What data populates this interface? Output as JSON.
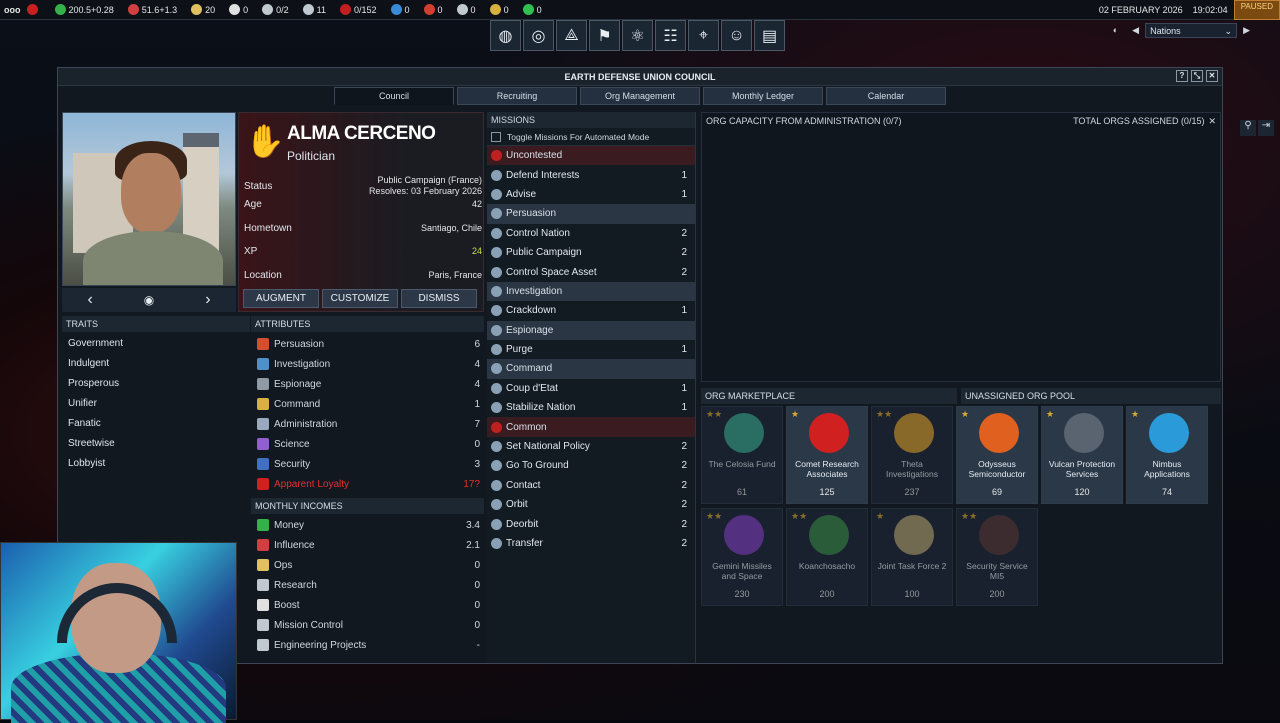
{
  "topbar": {
    "menu": "ooo",
    "resources": [
      {
        "name": "control-points",
        "value": "",
        "color": "#c82020"
      },
      {
        "name": "money",
        "value": "200.5+0.28",
        "color": "#36b04a"
      },
      {
        "name": "influence",
        "value": "51.6+1.3",
        "color": "#d04040"
      },
      {
        "name": "ops",
        "value": "20",
        "color": "#e0c060"
      },
      {
        "name": "boost",
        "value": "0",
        "color": "#e0e0e0"
      },
      {
        "name": "mission-control",
        "value": "0/2",
        "color": "#c0c8d0"
      },
      {
        "name": "research",
        "value": "11",
        "color": "#c0c8d0"
      },
      {
        "name": "mc-cap",
        "value": "0/152",
        "color": "#c02020"
      },
      {
        "name": "water",
        "value": "0",
        "color": "#3a8ad8"
      },
      {
        "name": "volatiles",
        "value": "0",
        "color": "#d04030"
      },
      {
        "name": "metals",
        "value": "0",
        "color": "#c0c8d0"
      },
      {
        "name": "noble-metals",
        "value": "0",
        "color": "#d8b040"
      },
      {
        "name": "fissiles",
        "value": "0",
        "color": "#30c050"
      }
    ],
    "date": "02 FEBRUARY 2026",
    "time": "19:02:04",
    "paused": "PAUSED",
    "nations_select": "Nations"
  },
  "window": {
    "title": "EARTH DEFENSE UNION COUNCIL",
    "tabs": [
      "Council",
      "Recruiting",
      "Org Management",
      "Monthly Ledger",
      "Calendar"
    ]
  },
  "councilor": {
    "name": "ALMA CERCENO",
    "role": "Politician",
    "status_label": "Status",
    "status_value": "Public Campaign (France)",
    "status_resolves": "Resolves: 03 February 2026",
    "age_label": "Age",
    "age": "42",
    "hometown_label": "Hometown",
    "hometown": "Santiago, Chile",
    "xp_label": "XP",
    "xp": "24",
    "location_label": "Location",
    "location": "Paris, France",
    "buttons": {
      "augment": "AUGMENT",
      "customize": "CUSTOMIZE",
      "dismiss": "DISMISS"
    }
  },
  "traits": {
    "header": "TRAITS",
    "items": [
      "Government",
      "Indulgent",
      "Prosperous",
      "Unifier",
      "Fanatic",
      "Streetwise",
      "Lobbyist"
    ]
  },
  "attributes": {
    "header": "ATTRIBUTES",
    "items": [
      {
        "label": "Persuasion",
        "value": "6",
        "color": "#d05030"
      },
      {
        "label": "Investigation",
        "value": "4",
        "color": "#5090c8"
      },
      {
        "label": "Espionage",
        "value": "4",
        "color": "#909aa4"
      },
      {
        "label": "Command",
        "value": "1",
        "color": "#d8b040"
      },
      {
        "label": "Administration",
        "value": "7",
        "color": "#9aa8c0"
      },
      {
        "label": "Science",
        "value": "0",
        "color": "#9060d0"
      },
      {
        "label": "Security",
        "value": "3",
        "color": "#4070c0"
      },
      {
        "label": "Apparent Loyalty",
        "value": "17?",
        "color": "#d02020"
      }
    ]
  },
  "incomes": {
    "header": "MONTHLY INCOMES",
    "items": [
      {
        "label": "Money",
        "value": "3.4",
        "color": "#36b04a"
      },
      {
        "label": "Influence",
        "value": "2.1",
        "color": "#d04040"
      },
      {
        "label": "Ops",
        "value": "0",
        "color": "#e0c060"
      },
      {
        "label": "Research",
        "value": "0",
        "color": "#c0c8d0"
      },
      {
        "label": "Boost",
        "value": "0",
        "color": "#e0e0e0"
      },
      {
        "label": "Mission Control",
        "value": "0",
        "color": "#c0c8d0"
      },
      {
        "label": "Engineering Projects",
        "value": "-",
        "color": "#c0c8d0"
      }
    ]
  },
  "missions": {
    "header": "MISSIONS",
    "toggle": "Toggle Missions For Automated Mode",
    "rows": [
      {
        "label": "Uncontested",
        "value": "",
        "cat": "red"
      },
      {
        "label": "Defend Interests",
        "value": "1",
        "cat": ""
      },
      {
        "label": "Advise",
        "value": "1",
        "cat": ""
      },
      {
        "label": "Persuasion",
        "value": "",
        "cat": "hdr"
      },
      {
        "label": "Control Nation",
        "value": "2",
        "cat": ""
      },
      {
        "label": "Public Campaign",
        "value": "2",
        "cat": ""
      },
      {
        "label": "Control Space Asset",
        "value": "2",
        "cat": ""
      },
      {
        "label": "Investigation",
        "value": "",
        "cat": "hdr"
      },
      {
        "label": "Crackdown",
        "value": "1",
        "cat": ""
      },
      {
        "label": "Espionage",
        "value": "",
        "cat": "hdr"
      },
      {
        "label": "Purge",
        "value": "1",
        "cat": ""
      },
      {
        "label": "Command",
        "value": "",
        "cat": "hdr"
      },
      {
        "label": "Coup d'Etat",
        "value": "1",
        "cat": ""
      },
      {
        "label": "Stabilize Nation",
        "value": "1",
        "cat": ""
      },
      {
        "label": "Common",
        "value": "",
        "cat": "red"
      },
      {
        "label": "Set National Policy",
        "value": "2",
        "cat": ""
      },
      {
        "label": "Go To Ground",
        "value": "2",
        "cat": ""
      },
      {
        "label": "Contact",
        "value": "2",
        "cat": ""
      },
      {
        "label": "Orbit",
        "value": "2",
        "cat": ""
      },
      {
        "label": "Deorbit",
        "value": "2",
        "cat": ""
      },
      {
        "label": "Transfer",
        "value": "2",
        "cat": ""
      }
    ]
  },
  "orgs": {
    "capacity": "ORG CAPACITY FROM ADMINISTRATION (0/7)",
    "total": "TOTAL ORGS ASSIGNED (0/15)",
    "marketplace": "ORG MARKETPLACE",
    "pool": "UNASSIGNED ORG POOL",
    "cards": [
      {
        "name": "The Celosia Fund",
        "cost": "61",
        "stars": "★★",
        "dim": true,
        "color": "#3aa890"
      },
      {
        "name": "Comet Research Associates",
        "cost": "125",
        "stars": "★",
        "dim": false,
        "color": "#d02020"
      },
      {
        "name": "Theta Investigations",
        "cost": "237",
        "stars": "★★",
        "dim": true,
        "color": "#d8a030"
      },
      {
        "name": "Odysseus Semiconductor",
        "cost": "69",
        "stars": "★",
        "dim": false,
        "color": "#e06020"
      },
      {
        "name": "Vulcan Protection Services",
        "cost": "120",
        "stars": "★",
        "dim": false,
        "color": "#5a6470"
      },
      {
        "name": "Nimbus Applications",
        "cost": "74",
        "stars": "★",
        "dim": false,
        "color": "#2a9ad8"
      },
      {
        "name": "Gemini Missiles and Space",
        "cost": "230",
        "stars": "★★",
        "dim": true,
        "color": "#8040c0"
      },
      {
        "name": "Koanchosacho",
        "cost": "200",
        "stars": "★★",
        "dim": true,
        "color": "#3a8a4a"
      },
      {
        "name": "Joint Task Force 2",
        "cost": "100",
        "stars": "★",
        "dim": true,
        "color": "#b0a070"
      },
      {
        "name": "Security Service MI5",
        "cost": "200",
        "stars": "★★",
        "dim": true,
        "color": "#5a3a3a"
      }
    ]
  }
}
